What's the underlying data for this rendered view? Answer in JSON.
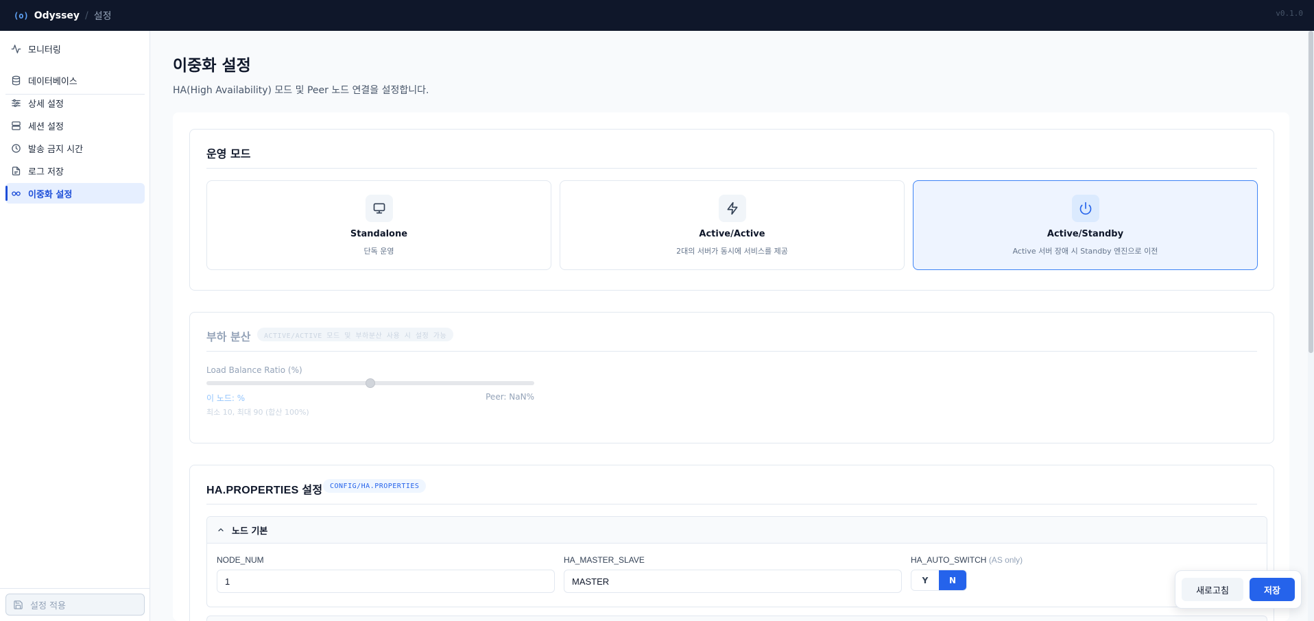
{
  "header": {
    "logo": "(o)",
    "app_name": "Odyssey",
    "separator": "/",
    "breadcrumb": "설정",
    "version": "v0.1.0"
  },
  "sidebar": {
    "items": [
      {
        "label": "모니터링",
        "icon": "activity-icon"
      },
      {
        "label": "데이터베이스",
        "icon": "database-icon"
      },
      {
        "label": "상세 설정",
        "icon": "sliders-icon"
      },
      {
        "label": "세션 설정",
        "icon": "server-icon"
      },
      {
        "label": "발송 금지 시간",
        "icon": "clock-icon"
      },
      {
        "label": "로그 저장",
        "icon": "file-text-icon"
      },
      {
        "label": "이중화 설정",
        "icon": "link-icon",
        "active": true
      }
    ],
    "apply_label": "설정 적용"
  },
  "page": {
    "title": "이중화 설정",
    "description": "HA(High Availability) 모드 및 Peer 노드 연결을 설정합니다."
  },
  "mode_section": {
    "title": "운영 모드",
    "modes": [
      {
        "name": "Standalone",
        "desc": "단독 운영",
        "icon": "monitor-icon"
      },
      {
        "name": "Active/Active",
        "desc": "2대의 서버가 동시에 서비스를 제공",
        "icon": "zap-icon"
      },
      {
        "name": "Active/Standby",
        "desc": "Active 서버 장애 시 Standby 엔진으로 이전",
        "icon": "power-icon",
        "selected": true
      }
    ]
  },
  "load_balance": {
    "title": "부하 분산",
    "badge": "ACTIVE/ACTIVE 모드 및 부하분산 사용 시 설정 가능",
    "ratio_label": "Load Balance Ratio (%)",
    "slider_value": 50,
    "slider_min": 0,
    "slider_max": 100,
    "self_label": "이 노드: %",
    "peer_label": "Peer: NaN%",
    "hint": "최소 10, 최대 90 (합산 100%)"
  },
  "ha_properties": {
    "title": "HA.PROPERTIES 설정",
    "path_badge": "CONFIG/HA.PROPERTIES",
    "section_title": "노드 기본",
    "fields": {
      "node_num_label": "NODE_NUM",
      "node_num_value": "1",
      "master_slave_label": "HA_MASTER_SLAVE",
      "master_slave_value": "MASTER",
      "auto_switch_label": "HA_AUTO_SWITCH",
      "auto_switch_hint": "(AS only)",
      "auto_switch_yes": "Y",
      "auto_switch_no": "N",
      "auto_switch_selected": "N"
    }
  },
  "actions": {
    "refresh_label": "새로고침",
    "save_label": "저장"
  },
  "colors": {
    "topbar": "#0f172a",
    "accent": "#2563eb",
    "selected_bg": "#eef4ff"
  }
}
